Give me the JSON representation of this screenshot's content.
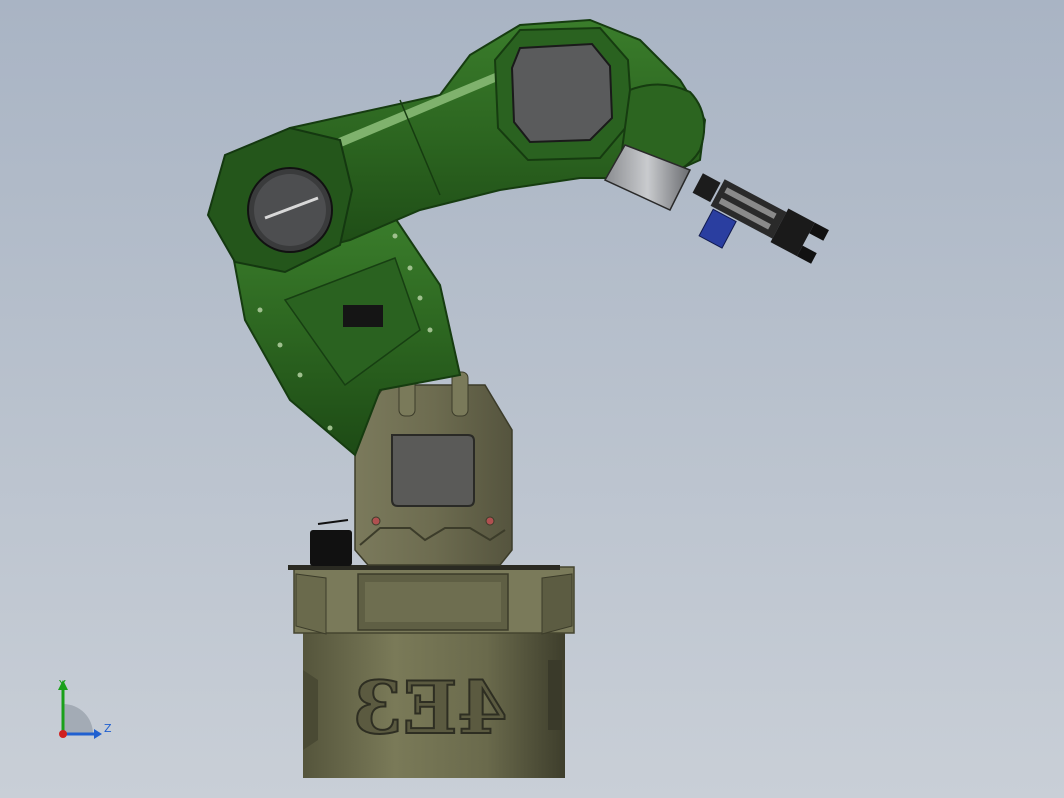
{
  "viewport": {
    "model_engraving": "4E3",
    "triad": {
      "x_label": "",
      "y_label": "Y",
      "z_label": "Z"
    },
    "colors": {
      "background_top": "#a9b4c4",
      "background_bottom": "#c9cfd7",
      "arm_green": "#2f6b22",
      "arm_green_dark": "#1f4c17",
      "arm_highlight": "#7fb26d",
      "base_olive": "#6a6a4c",
      "base_olive_dark": "#4a4a34",
      "motor_gray": "#5a5c60",
      "gripper_blue": "#2a3ea0",
      "gripper_black": "#1c1c1c",
      "axis_y": "#1aa01a",
      "axis_z": "#2060d0",
      "axis_x": "#d02020"
    }
  }
}
